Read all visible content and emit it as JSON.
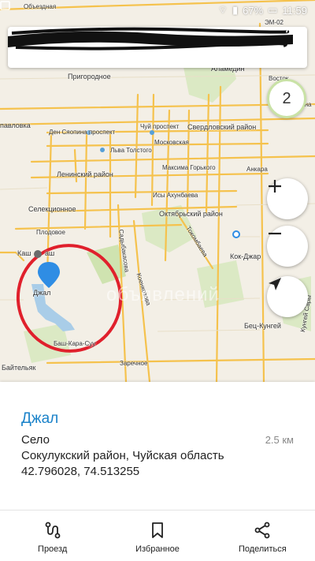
{
  "status": {
    "battery": "67%",
    "time": "11:59"
  },
  "layer_badge": "2",
  "map": {
    "labels": {
      "obyezdnaya": "Объездная",
      "alamedin": "Аламедин",
      "em02": "ЭМ-02",
      "prigorodnoe": "Пригородное",
      "vostok": "Восток",
      "lenina": "Ленина",
      "pavlovka": "павловка",
      "den_syaopina": "Ден Сяопина проспект",
      "chuy": "Чуй проспект",
      "sverdlovskiy": "Свердловский район",
      "moskovskaya": "Московская",
      "lva_tolstogo": "Льва Толстого",
      "maksima_gorkogo": "Максима Горького",
      "ankara": "Анкара",
      "leninskiy": "Ленинский район",
      "isy_akhunbaeva": "Исы Ахунбаева",
      "oktyabrskiy": "Октябрьский район",
      "selektsionnoe": "Селекционное",
      "plodovoe": "Плодовое",
      "kashkar": "Каш",
      "kashkar2": "аш",
      "tokombaeva": "Токомбаева",
      "kok_jar": "Кок-Джар",
      "sadybakasova": "Садыбакасова",
      "koenkozova": "Коенкозова",
      "jal": "Джал",
      "bash_kara_suu": "Баш-Кара-Суу",
      "bets_kungey": "Бец-Кунгей",
      "zarechnoe": "Заречное",
      "baytelyak": "Байтельяк",
      "kungey_sary": "Кунгей Сары",
      "watermark": "объявлений"
    }
  },
  "place": {
    "title": "Джал",
    "type": "Село",
    "distance": "2.5 км",
    "region": "Сокулукский район, Чуйская область",
    "coordinates": "42.796028, 74.513255"
  },
  "nav": {
    "route": "Проезд",
    "favorites": "Избранное",
    "share": "Поделиться"
  },
  "colors": {
    "road": "#f5c24d",
    "accent": "#1a82c9",
    "circle": "#e0202c",
    "green": "#cfe3b0",
    "water": "#a9cde8"
  }
}
